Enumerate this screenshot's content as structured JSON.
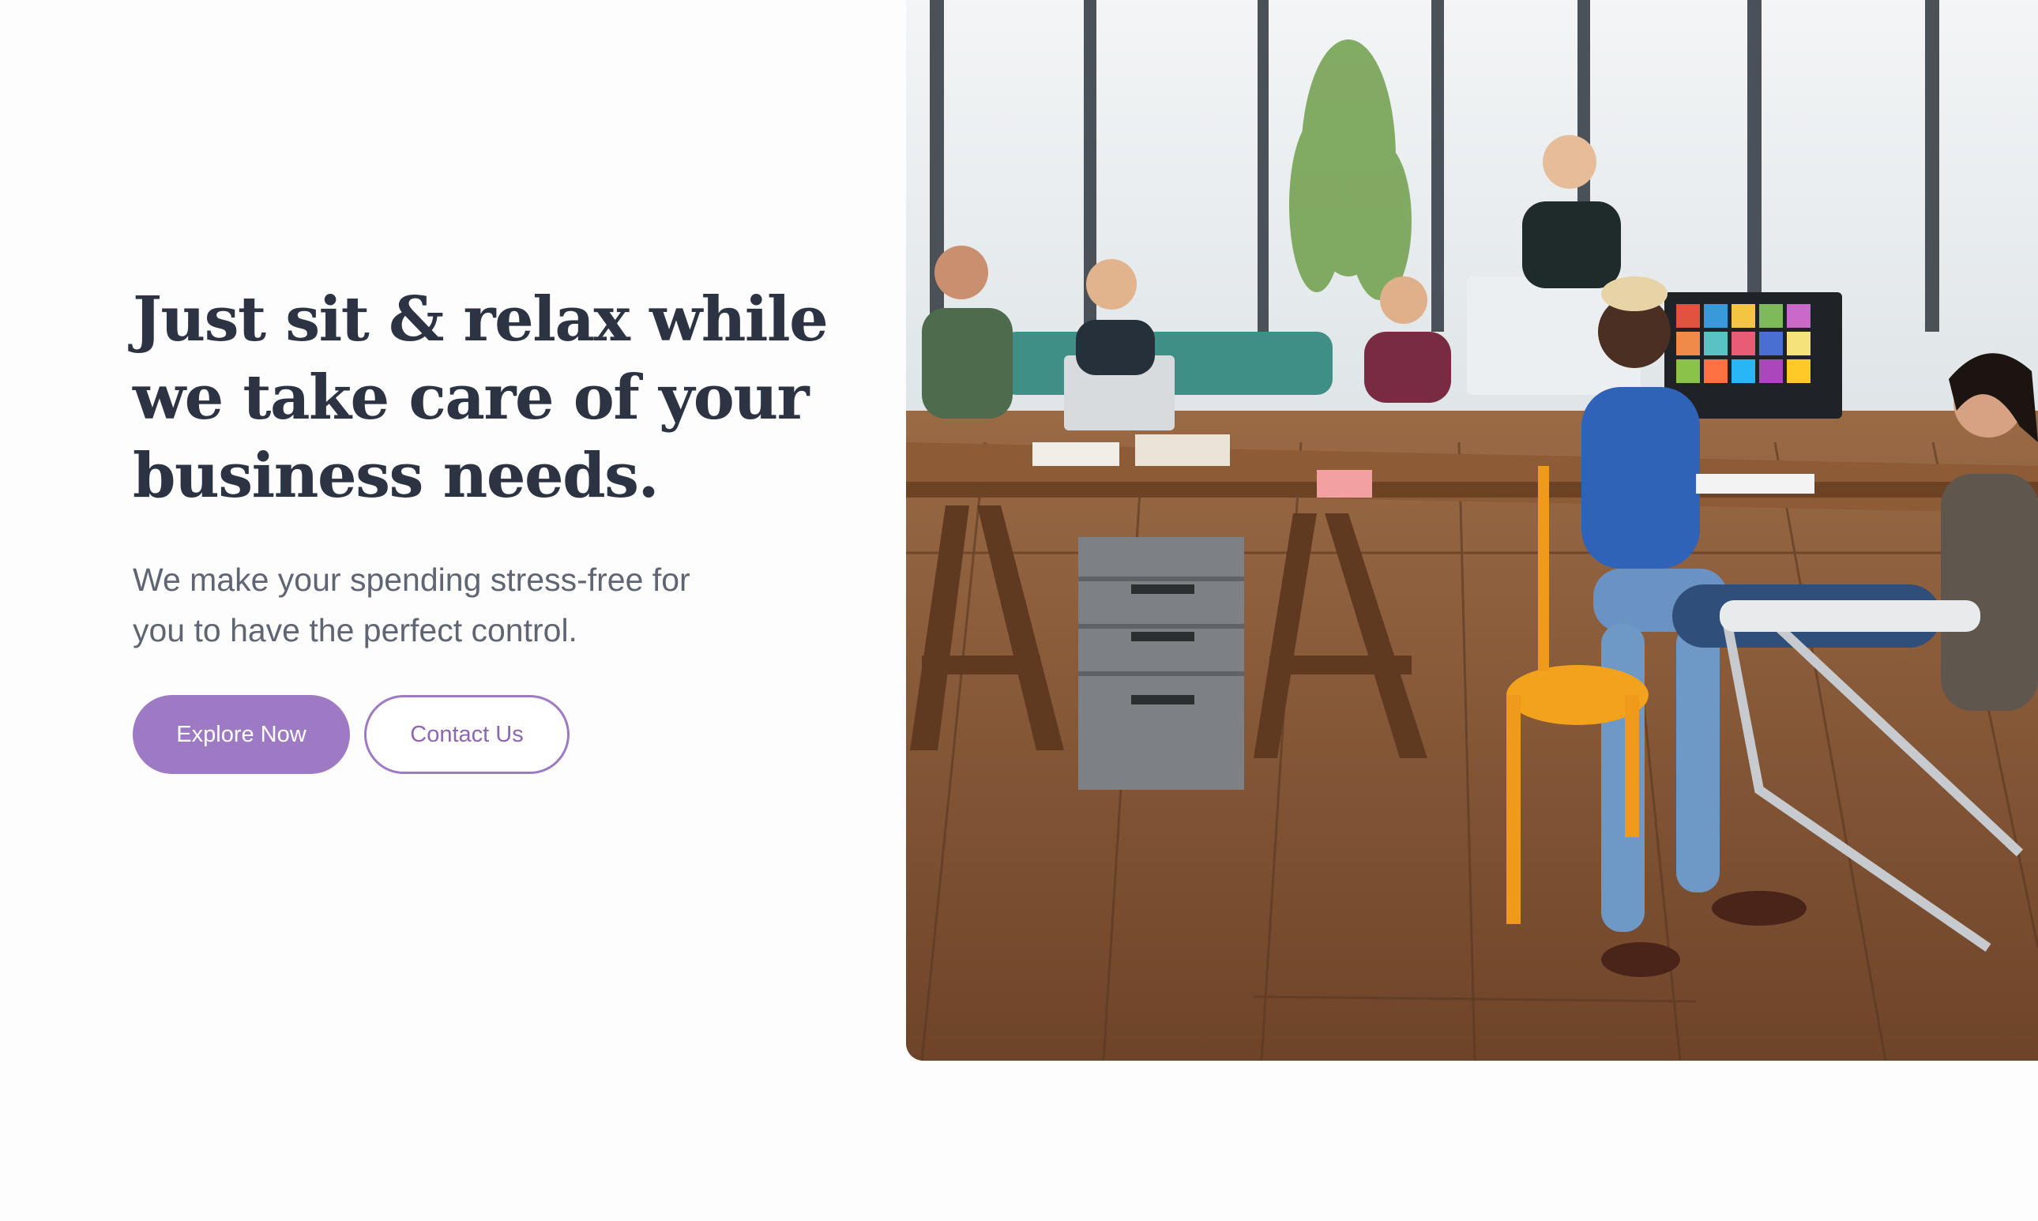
{
  "hero": {
    "headline_lines": [
      "Just sit & relax while",
      "we take care of your",
      "business needs."
    ],
    "subtext_lines": [
      "We make your spending stress-free for",
      "you to have the perfect control."
    ],
    "primary_button_label": "Explore Now",
    "secondary_button_label": "Contact Us"
  },
  "colors": {
    "headline": "#2c3444",
    "body_text": "#5f6572",
    "accent": "#9d7ac3",
    "background": "#fdfdfe"
  },
  "image": {
    "description_icon": "office-team-photo"
  }
}
